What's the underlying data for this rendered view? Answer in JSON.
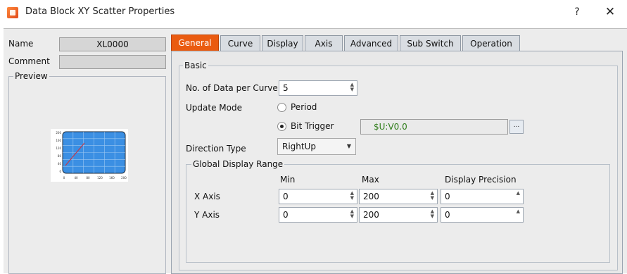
{
  "window": {
    "title": "Data Block XY Scatter Properties",
    "help": "?",
    "close": "✕"
  },
  "left": {
    "name_label": "Name",
    "name_value": "XL0000",
    "comment_label": "Comment",
    "comment_value": "",
    "preview_label": "Preview"
  },
  "tabs": [
    "General",
    "Curve",
    "Display",
    "Axis",
    "Advanced",
    "Sub Switch",
    "Operation"
  ],
  "active_tab": "General",
  "basic": {
    "group_label": "Basic",
    "data_per_curve_label": "No. of Data per Curve",
    "data_per_curve_value": "5",
    "update_mode_label": "Update Mode",
    "update_mode_options": [
      "Period",
      "Bit Trigger"
    ],
    "update_mode_selected": "Bit Trigger",
    "bit_trigger_address": "$U:V0.0",
    "browse_label": "...",
    "direction_label": "Direction Type",
    "direction_value": "RightUp"
  },
  "range": {
    "group_label": "Global Display Range",
    "col_min": "Min",
    "col_max": "Max",
    "col_precision": "Display Precision",
    "rows": [
      {
        "label": "X Axis",
        "min": "0",
        "max": "200",
        "precision": "0"
      },
      {
        "label": "Y Axis",
        "min": "0",
        "max": "200",
        "precision": "0"
      }
    ]
  },
  "preview_chart": {
    "y_ticks": [
      "200",
      "160",
      "120",
      "80",
      "40",
      "0"
    ],
    "x_ticks": [
      "0",
      "40",
      "80",
      "120",
      "160",
      "200"
    ]
  },
  "colors": {
    "accent": "#ea5b10",
    "plot_bg": "#3b8fe3",
    "curve": "#c23a4a",
    "address_text": "#2f7d1a"
  }
}
